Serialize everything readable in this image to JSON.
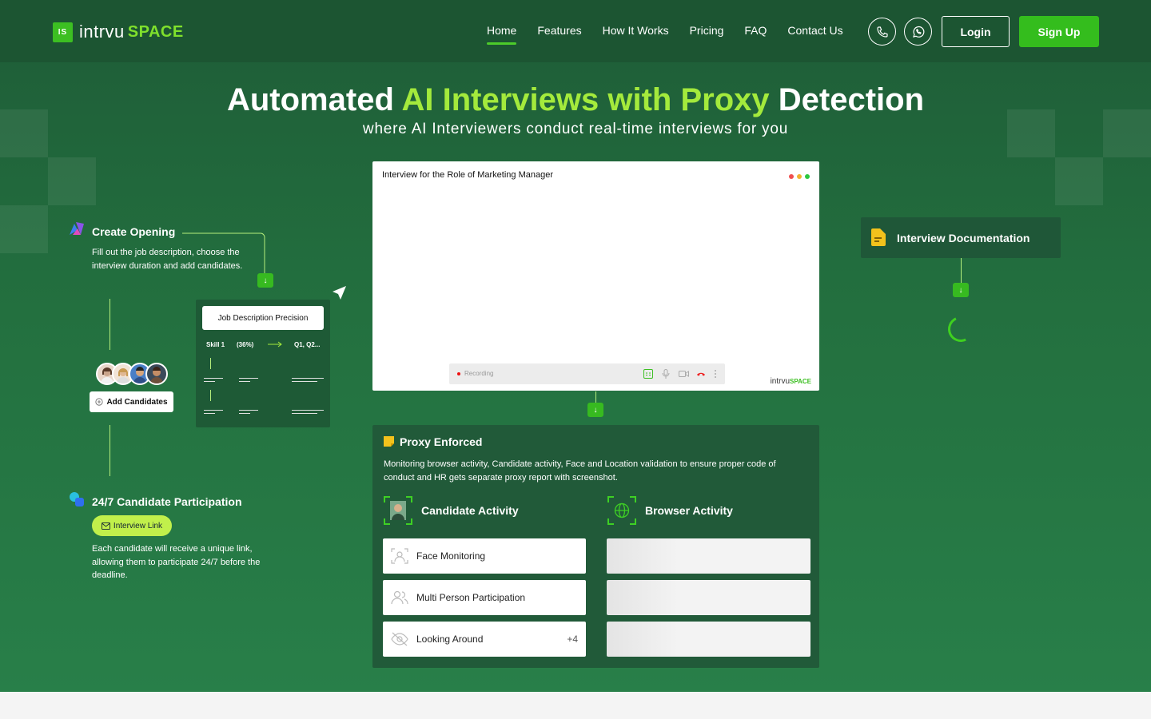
{
  "brand": {
    "mark": "IS",
    "name_part1": "intrvu",
    "name_part2": "SPACE"
  },
  "nav": {
    "items": [
      "Home",
      "Features",
      "How It Works",
      "Pricing",
      "FAQ",
      "Contact Us"
    ],
    "active": "Home"
  },
  "header_actions": {
    "phone_icon": "phone-icon",
    "whatsapp_icon": "whatsapp-icon",
    "login": "Login",
    "signup": "Sign Up"
  },
  "hero": {
    "title_part1": "Automated ",
    "title_highlight": "AI Interviews with Proxy",
    "title_part2": " Detection",
    "subtitle": "where AI Interviewers conduct real-time interviews for you"
  },
  "create_opening": {
    "title": "Create Opening",
    "description": "Fill out the job description, choose the interview duration and add candidates."
  },
  "candidates": {
    "add_label": "Add Candidates"
  },
  "jd_panel": {
    "pill": "Job Description Precision",
    "skill": "Skill 1",
    "percent": "(36%)",
    "questions": "Q1, Q2..."
  },
  "participation": {
    "title": "24/7 Candidate Participation",
    "link_label": "Interview Link",
    "description": "Each candidate will receive a unique link, allowing them to participate 24/7 before the deadline."
  },
  "video": {
    "title": "Interview for the Role of Marketing Manager",
    "recording": "Recording",
    "logo_part1": "intrvu",
    "logo_part2": "SPACE"
  },
  "proxy": {
    "title": "Proxy Enforced",
    "description": "Monitoring browser activity, Candidate activity, Face and Location validation to ensure proper code of conduct and HR gets separate proxy report with screenshot.",
    "candidate_activity": {
      "title": "Candidate Activity",
      "items": [
        {
          "label": "Face Monitoring",
          "icon": "face-scan-icon"
        },
        {
          "label": "Multi Person Participation",
          "icon": "people-icon"
        },
        {
          "label": "Looking Around",
          "icon": "eye-off-icon",
          "count": "+4"
        }
      ]
    },
    "browser_activity": {
      "title": "Browser Activity"
    }
  },
  "documentation": {
    "title": "Interview Documentation"
  },
  "colors": {
    "bg_dark": "#1c5532",
    "accent_green": "#34bd1d",
    "highlight": "#a4ea3c",
    "link_pill": "#c1f04b"
  }
}
